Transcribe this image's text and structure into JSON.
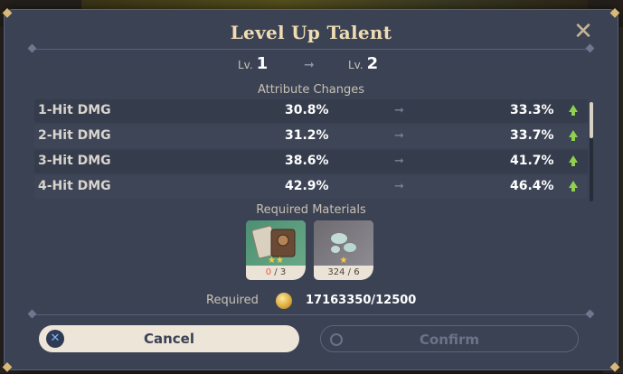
{
  "dialog": {
    "title": "Level Up Talent",
    "close_icon": "close-x-icon"
  },
  "level": {
    "prefix": "Lv.",
    "from": "1",
    "to": "2"
  },
  "attributes": {
    "heading": "Attribute Changes",
    "rows": [
      {
        "name": "1-Hit DMG",
        "old": "30.8%",
        "new": "33.3%"
      },
      {
        "name": "2-Hit DMG",
        "old": "31.2%",
        "new": "33.7%"
      },
      {
        "name": "3-Hit DMG",
        "old": "38.6%",
        "new": "41.7%"
      },
      {
        "name": "4-Hit DMG",
        "old": "42.9%",
        "new": "46.4%"
      }
    ]
  },
  "materials": {
    "heading": "Required Materials",
    "items": [
      {
        "icon": "talent-book-icon",
        "stars": "★★",
        "owned": "0",
        "needed": "3",
        "sep": " / "
      },
      {
        "icon": "slime-condensate-icon",
        "stars": "★",
        "owned": "324",
        "needed": "6",
        "sep": " / "
      }
    ]
  },
  "cost": {
    "label": "Required",
    "icon": "mora-coin-icon",
    "value": "17163350/12500"
  },
  "buttons": {
    "cancel": "Cancel",
    "confirm": "Confirm"
  },
  "colors": {
    "panel": "#3b4254",
    "title": "#efdcb2",
    "increase": "#8fd04d",
    "lacking": "#e55b4f"
  }
}
